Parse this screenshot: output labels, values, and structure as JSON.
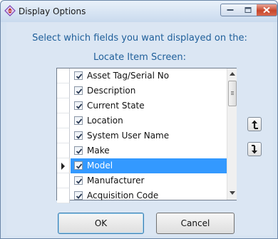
{
  "window": {
    "title": "Display Options",
    "controls": {
      "minimize": "minimize-icon",
      "maximize": "maximize-icon",
      "close": "close-icon"
    },
    "close_color": "#c7462b"
  },
  "heading_line1": "Select which fields you want displayed on the:",
  "heading_line2": "Locate Item Screen:",
  "heading_color": "#1f5f9a",
  "fields": [
    {
      "label": "Asset Tag/Serial No",
      "checked": true,
      "selected": false
    },
    {
      "label": "Description",
      "checked": true,
      "selected": false
    },
    {
      "label": "Current State",
      "checked": true,
      "selected": false
    },
    {
      "label": "Location",
      "checked": true,
      "selected": false
    },
    {
      "label": "System User Name",
      "checked": true,
      "selected": false
    },
    {
      "label": "Make",
      "checked": true,
      "selected": false
    },
    {
      "label": "Model",
      "checked": true,
      "selected": true
    },
    {
      "label": "Manufacturer",
      "checked": true,
      "selected": false
    },
    {
      "label": "Acquisition Code",
      "checked": true,
      "selected": false
    }
  ],
  "selection_color": "#3399ff",
  "side_buttons": {
    "move_up": "move-up-icon",
    "move_down": "move-down-icon"
  },
  "buttons": {
    "ok": "OK",
    "cancel": "Cancel"
  }
}
